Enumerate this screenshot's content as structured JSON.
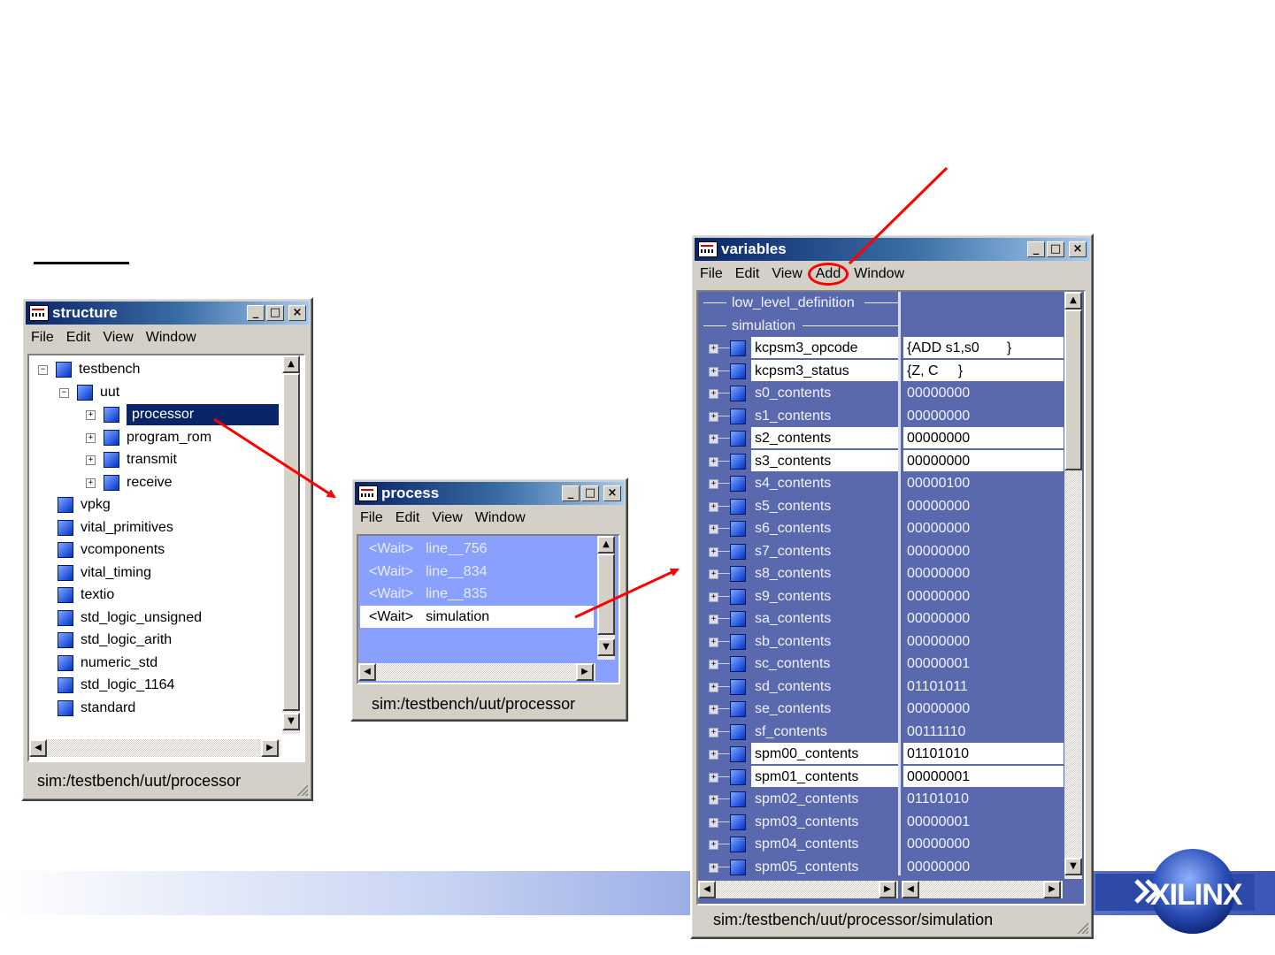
{
  "structure_window": {
    "title": "structure",
    "menu": [
      "File",
      "Edit",
      "View",
      "Window"
    ],
    "tree": [
      {
        "label": "testbench",
        "level": 0,
        "expander": "minus"
      },
      {
        "label": "uut",
        "level": 1,
        "expander": "minus"
      },
      {
        "label": "processor",
        "level": 2,
        "expander": "plus",
        "selected": true
      },
      {
        "label": "program_rom",
        "level": 2,
        "expander": "plus"
      },
      {
        "label": "transmit",
        "level": 2,
        "expander": "plus"
      },
      {
        "label": "receive",
        "level": 2,
        "expander": "plus"
      },
      {
        "label": "vpkg",
        "level": 0
      },
      {
        "label": "vital_primitives",
        "level": 0
      },
      {
        "label": "vcomponents",
        "level": 0
      },
      {
        "label": "vital_timing",
        "level": 0
      },
      {
        "label": "textio",
        "level": 0
      },
      {
        "label": "std_logic_unsigned",
        "level": 0
      },
      {
        "label": "std_logic_arith",
        "level": 0
      },
      {
        "label": "numeric_std",
        "level": 0
      },
      {
        "label": "std_logic_1164",
        "level": 0
      },
      {
        "label": "standard",
        "level": 0
      }
    ],
    "status": "sim:/testbench/uut/processor"
  },
  "process_window": {
    "title": "process",
    "menu": [
      "File",
      "Edit",
      "View",
      "Window"
    ],
    "rows": [
      {
        "state": "<Wait>",
        "name": "line__756"
      },
      {
        "state": "<Wait>",
        "name": "line__834"
      },
      {
        "state": "<Wait>",
        "name": "line__835"
      },
      {
        "state": "<Wait>",
        "name": "simulation",
        "highlighted": true
      }
    ],
    "status": "sim:/testbench/uut/processor"
  },
  "variables_window": {
    "title": "variables",
    "menu": [
      "File",
      "Edit",
      "View",
      "Add",
      "Window"
    ],
    "sections": [
      "low_level_definition",
      "simulation"
    ],
    "rows": [
      {
        "name": "kcpsm3_opcode",
        "value": "{ADD s1,s0       }",
        "highlighted": true
      },
      {
        "name": "kcpsm3_status",
        "value": "{Z, C     }",
        "highlighted": true
      },
      {
        "name": "s0_contents",
        "value": "00000000"
      },
      {
        "name": "s1_contents",
        "value": "00000000"
      },
      {
        "name": "s2_contents",
        "value": "00000000",
        "highlighted": true
      },
      {
        "name": "s3_contents",
        "value": "00000000",
        "highlighted": true
      },
      {
        "name": "s4_contents",
        "value": "00000100"
      },
      {
        "name": "s5_contents",
        "value": "00000000"
      },
      {
        "name": "s6_contents",
        "value": "00000000"
      },
      {
        "name": "s7_contents",
        "value": "00000000"
      },
      {
        "name": "s8_contents",
        "value": "00000000"
      },
      {
        "name": "s9_contents",
        "value": "00000000"
      },
      {
        "name": "sa_contents",
        "value": "00000000"
      },
      {
        "name": "sb_contents",
        "value": "00000000"
      },
      {
        "name": "sc_contents",
        "value": "00000001"
      },
      {
        "name": "sd_contents",
        "value": "01101011"
      },
      {
        "name": "se_contents",
        "value": "00000000"
      },
      {
        "name": "sf_contents",
        "value": "00111110"
      },
      {
        "name": "spm00_contents",
        "value": "01101010",
        "highlighted": true
      },
      {
        "name": "spm01_contents",
        "value": "00000001",
        "highlighted": true
      },
      {
        "name": "spm02_contents",
        "value": "01101010"
      },
      {
        "name": "spm03_contents",
        "value": "00000001"
      },
      {
        "name": "spm04_contents",
        "value": "00000000"
      },
      {
        "name": "spm05_contents",
        "value": "00000000"
      }
    ],
    "status": "sim:/testbench/uut/processor/simulation"
  },
  "logo": {
    "text": "XILINX"
  },
  "colors": {
    "annotation": "#ff0000",
    "selection": "#0a246a",
    "variables_bg": "#5a68ad",
    "process_bg": "#8aa0ff"
  }
}
